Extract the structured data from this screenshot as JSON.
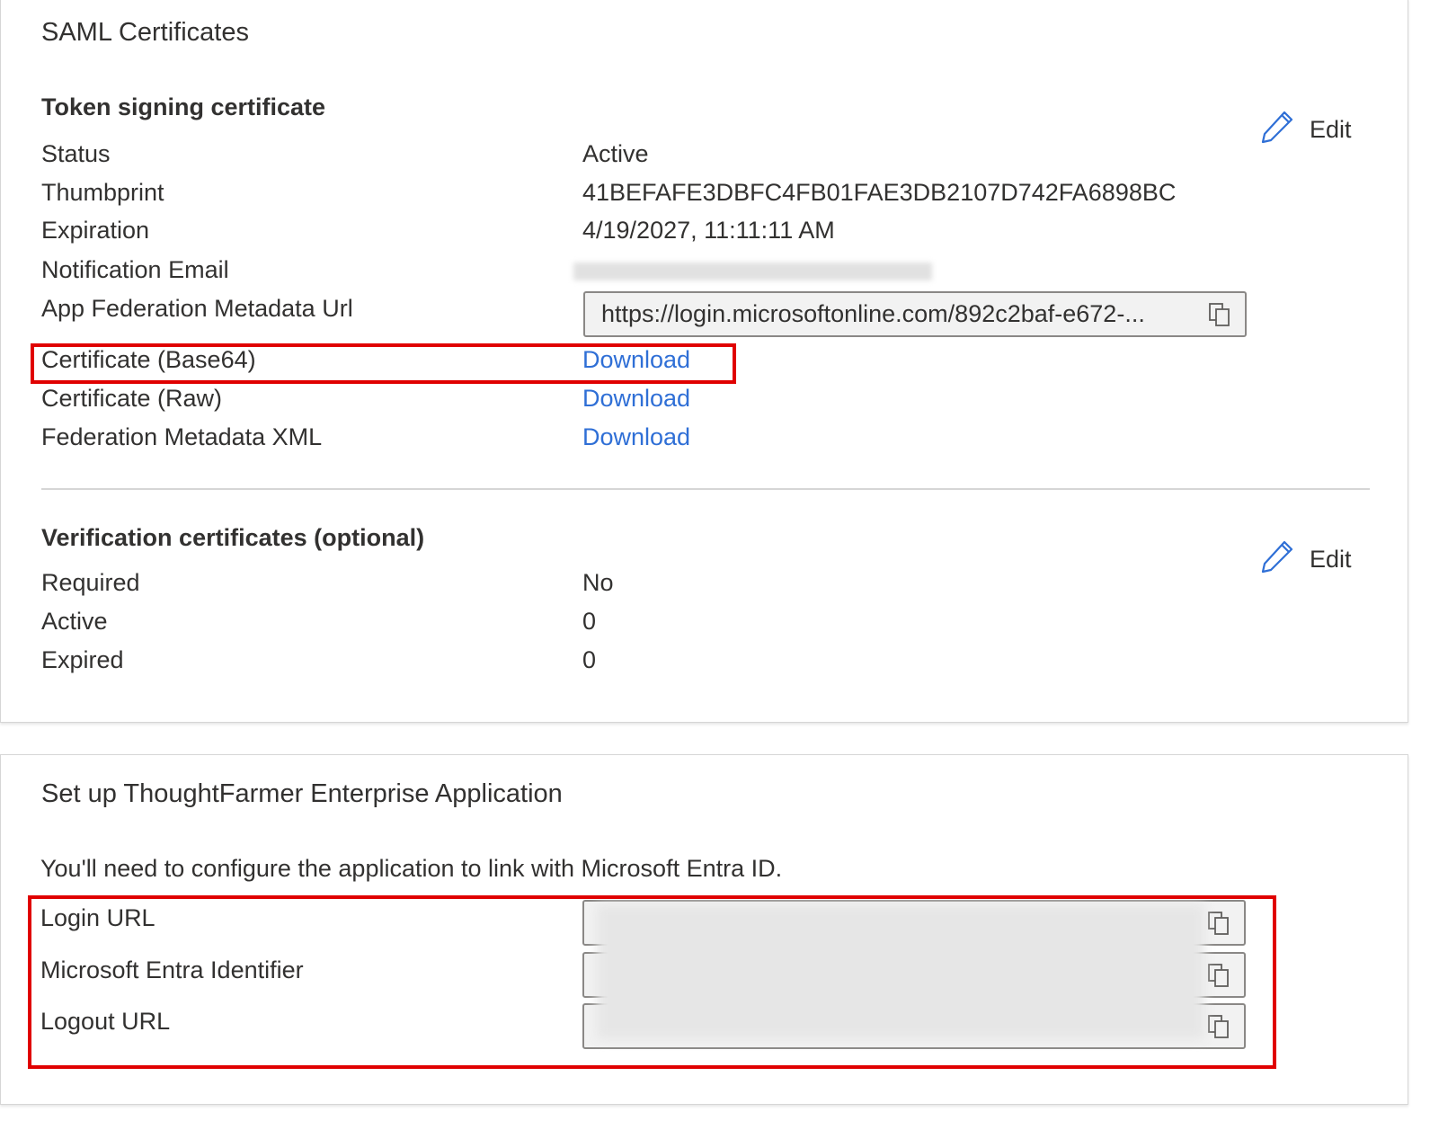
{
  "colors": {
    "link": "#2f6fd6",
    "highlight_border": "#e00000",
    "text": "#323130"
  },
  "saml_certificates": {
    "title": "SAML Certificates",
    "token_signing": {
      "heading": "Token signing certificate",
      "edit_label": "Edit",
      "rows": [
        {
          "label": "Status",
          "value": "Active"
        },
        {
          "label": "Thumbprint",
          "value": "41BEFAFE3DBFC4FB01FAE3DB2107D742FA6898BC"
        },
        {
          "label": "Expiration",
          "value": "4/19/2027, 11:11:11 AM"
        },
        {
          "label": "Notification Email",
          "value": ""
        },
        {
          "label": "App Federation Metadata Url",
          "value": "https://login.microsoftonline.com/892c2baf-e672-..."
        },
        {
          "label": "Certificate (Base64)",
          "value": "Download"
        },
        {
          "label": "Certificate (Raw)",
          "value": "Download"
        },
        {
          "label": "Federation Metadata XML",
          "value": "Download"
        }
      ]
    },
    "verification": {
      "heading": "Verification certificates (optional)",
      "edit_label": "Edit",
      "rows": [
        {
          "label": "Required",
          "value": "No"
        },
        {
          "label": "Active",
          "value": "0"
        },
        {
          "label": "Expired",
          "value": "0"
        }
      ]
    }
  },
  "setup": {
    "title": "Set up ThoughtFarmer Enterprise Application",
    "description": "You'll need to configure the application to link with Microsoft Entra ID.",
    "rows": [
      {
        "label": "Login URL",
        "value": ""
      },
      {
        "label": "Microsoft Entra Identifier",
        "value": ""
      },
      {
        "label": "Logout URL",
        "value": ""
      }
    ]
  }
}
